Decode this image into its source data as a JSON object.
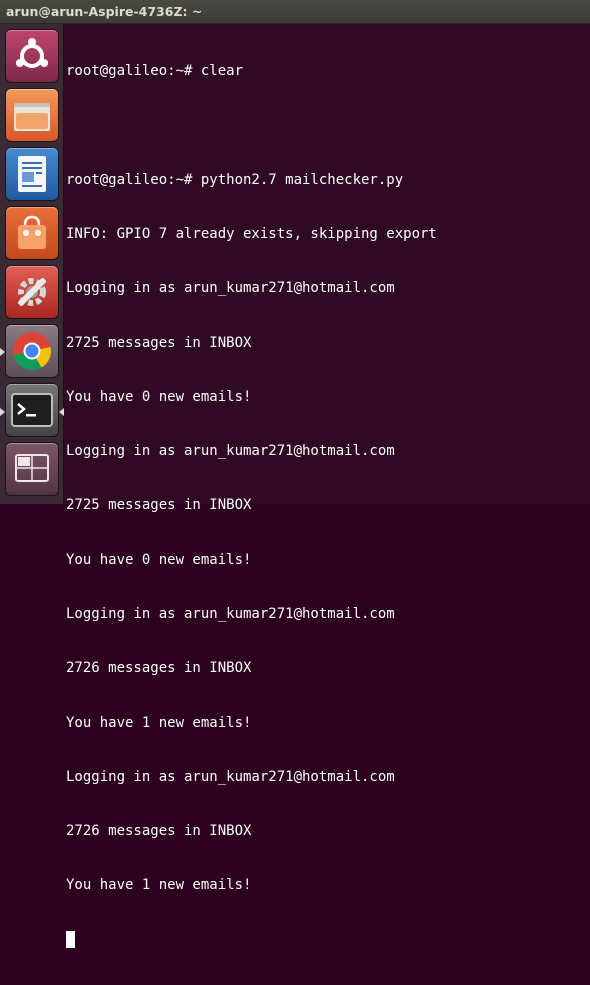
{
  "window": {
    "title": "arun@arun-Aspire-4736Z: ~"
  },
  "launcher": {
    "items": [
      {
        "name": "dash-home",
        "icon": "ubuntu-logo-icon"
      },
      {
        "name": "files",
        "icon": "folder-icon"
      },
      {
        "name": "writer",
        "icon": "document-icon"
      },
      {
        "name": "software-center",
        "icon": "shopping-bag-icon"
      },
      {
        "name": "system-settings",
        "icon": "wrench-gear-icon"
      },
      {
        "name": "chrome",
        "icon": "chrome-icon"
      },
      {
        "name": "terminal",
        "icon": "terminal-icon"
      },
      {
        "name": "workspace-switcher",
        "icon": "workspace-icon"
      }
    ]
  },
  "terminal": {
    "lines": [
      "root@galileo:~# clear",
      "",
      "root@galileo:~# python2.7 mailchecker.py",
      "INFO: GPIO 7 already exists, skipping export",
      "Logging in as arun_kumar271@hotmail.com",
      "2725 messages in INBOX",
      "You have 0 new emails!",
      "Logging in as arun_kumar271@hotmail.com",
      "2725 messages in INBOX",
      "You have 0 new emails!",
      "Logging in as arun_kumar271@hotmail.com",
      "2726 messages in INBOX",
      "You have 1 new emails!",
      "Logging in as arun_kumar271@hotmail.com",
      "2726 messages in INBOX",
      "You have 1 new emails!"
    ]
  },
  "colors": {
    "terminal_bg": "#300a24",
    "launcher_bg": "#3b2a36",
    "text": "#ffffff"
  }
}
